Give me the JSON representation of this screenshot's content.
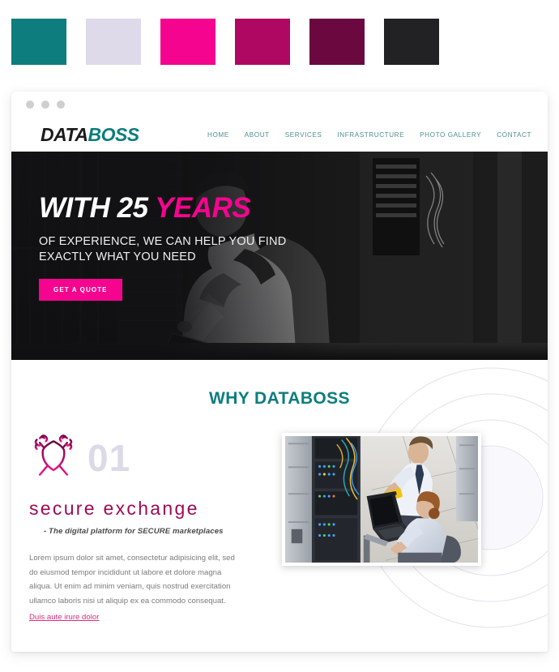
{
  "palette": {
    "label": "brand-color-swatches",
    "swatches": [
      {
        "name": "teal",
        "hex": "#0D7D7E"
      },
      {
        "name": "lavender",
        "hex": "#DEDAE9"
      },
      {
        "name": "bright-pink",
        "hex": "#F5048F"
      },
      {
        "name": "magenta",
        "hex": "#AF0862"
      },
      {
        "name": "dark-plum",
        "hex": "#6B0840"
      },
      {
        "name": "near-black",
        "hex": "#222224"
      }
    ]
  },
  "browser": {
    "dots": [
      "dot-red",
      "dot-yellow",
      "dot-green"
    ]
  },
  "header": {
    "logo_first": "DATA",
    "logo_second": "BOSS",
    "nav": [
      {
        "label": "HOME"
      },
      {
        "label": "ABOUT"
      },
      {
        "label": "SERVICES"
      },
      {
        "label": "INFRASTRUCTURE"
      },
      {
        "label": "PHOTO GALLERY"
      },
      {
        "label": "CONTACT"
      }
    ]
  },
  "hero": {
    "title_plain": "WITH 25 ",
    "title_accent": "YEARS",
    "subtitle_line1": "OF EXPERIENCE, WE CAN HELP YOU FIND",
    "subtitle_line2": "EXACTLY WHAT YOU NEED",
    "cta_label": "GET A QUOTE",
    "image_alt": "man-with-backpack-writing-on-tablet-in-data-center"
  },
  "why": {
    "section_title": "WHY DATABOSS",
    "feature": {
      "icon_name": "shield-with-crossed-swords-icon",
      "number": "01",
      "title": "secure exchange",
      "tagline": "- The digital platform for SECURE marketplaces",
      "body": "Lorem ipsum dolor sit amet, consectetur adipisicing elit, sed do eiusmod tempor incididunt ut labore et dolore magna aliqua. Ut enim ad minim veniam, quis nostrud exercitation ullamco laboris nisi ut aliquip ex ea commodo consequat.",
      "link_label": "Duis aute irure dolor",
      "image_alt": "two-technicians-working-on-server-racks-in-data-center"
    }
  }
}
